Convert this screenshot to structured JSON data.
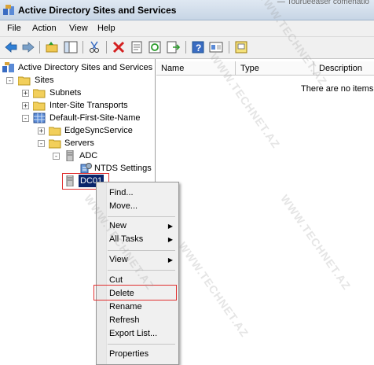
{
  "window": {
    "title": "Active Directory Sites and Services",
    "background_text": "— Tourueeaser comenatio"
  },
  "menu": [
    "File",
    "Action",
    "View",
    "Help"
  ],
  "toolbar": {
    "buttons": [
      "back-arrow-icon",
      "forward-arrow-icon",
      "up-folder-icon",
      "show-tree-icon",
      "cut-icon",
      "delete-icon",
      "properties-icon",
      "refresh-icon",
      "export-icon",
      "help-icon",
      "mmc-icon",
      "console-icon"
    ]
  },
  "tree": {
    "root": "Active Directory Sites and Services",
    "nodes": [
      {
        "label": "Sites",
        "expander": "-"
      },
      {
        "label": "Subnets",
        "expander": "+"
      },
      {
        "label": "Inter-Site Transports",
        "expander": "+"
      },
      {
        "label": "Default-First-Site-Name",
        "expander": "-"
      },
      {
        "label": "EdgeSyncService",
        "expander": "+"
      },
      {
        "label": "Servers",
        "expander": "-"
      },
      {
        "label": "ADC",
        "expander": "-"
      },
      {
        "label": "NTDS Settings",
        "expander": ""
      },
      {
        "label": "DC01",
        "expander": ""
      }
    ]
  },
  "list": {
    "columns": [
      "Name",
      "Type",
      "Description"
    ],
    "empty_message": "There are no items"
  },
  "context_menu": {
    "items": [
      "Find...",
      "Move...",
      "New",
      "All Tasks",
      "View",
      "Cut",
      "Delete",
      "Rename",
      "Refresh",
      "Export List...",
      "Properties"
    ]
  },
  "watermark": "WWW.TECHNET.AZ"
}
